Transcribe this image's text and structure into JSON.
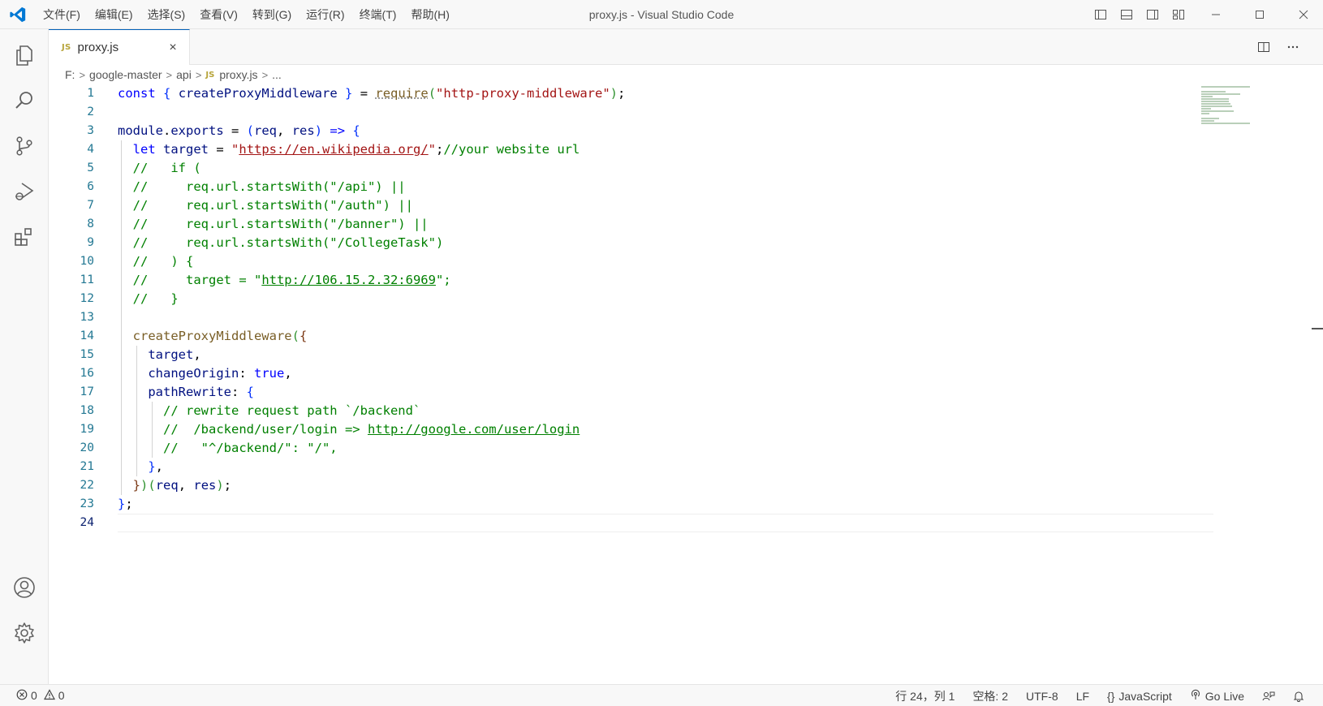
{
  "titlebar": {
    "window_title": "proxy.js - Visual Studio Code",
    "menus": [
      "文件(F)",
      "编辑(E)",
      "选择(S)",
      "查看(V)",
      "转到(G)",
      "运行(R)",
      "终端(T)",
      "帮助(H)"
    ]
  },
  "activitybar": {
    "items": [
      "explorer-icon",
      "search-icon",
      "source-control-icon",
      "run-debug-icon",
      "extensions-icon"
    ],
    "bottom": [
      "accounts-icon",
      "settings-gear-icon"
    ]
  },
  "tab": {
    "badge": "JS",
    "label": "proxy.js",
    "close": "×"
  },
  "breadcrumbs": {
    "drive": "F:",
    "folder1": "google-master",
    "folder2": "api",
    "badge": "JS",
    "file": "proxy.js",
    "more": "..."
  },
  "editor": {
    "line_numbers": [
      "1",
      "2",
      "3",
      "4",
      "5",
      "6",
      "7",
      "8",
      "9",
      "10",
      "11",
      "12",
      "13",
      "14",
      "15",
      "16",
      "17",
      "18",
      "19",
      "20",
      "21",
      "22",
      "23",
      "24"
    ],
    "active_line": 24
  },
  "statusbar": {
    "errors": "0",
    "warnings": "0",
    "position": "行 24，列 1",
    "indent": "空格: 2",
    "encoding": "UTF-8",
    "eol": "LF",
    "language_icon": "{}",
    "language": "JavaScript",
    "golive": "Go Live"
  },
  "colors": {
    "accent": "#005fb8",
    "line_number": "#237893",
    "comment": "#008000",
    "string": "#a31515",
    "keyword": "#0000ff"
  }
}
